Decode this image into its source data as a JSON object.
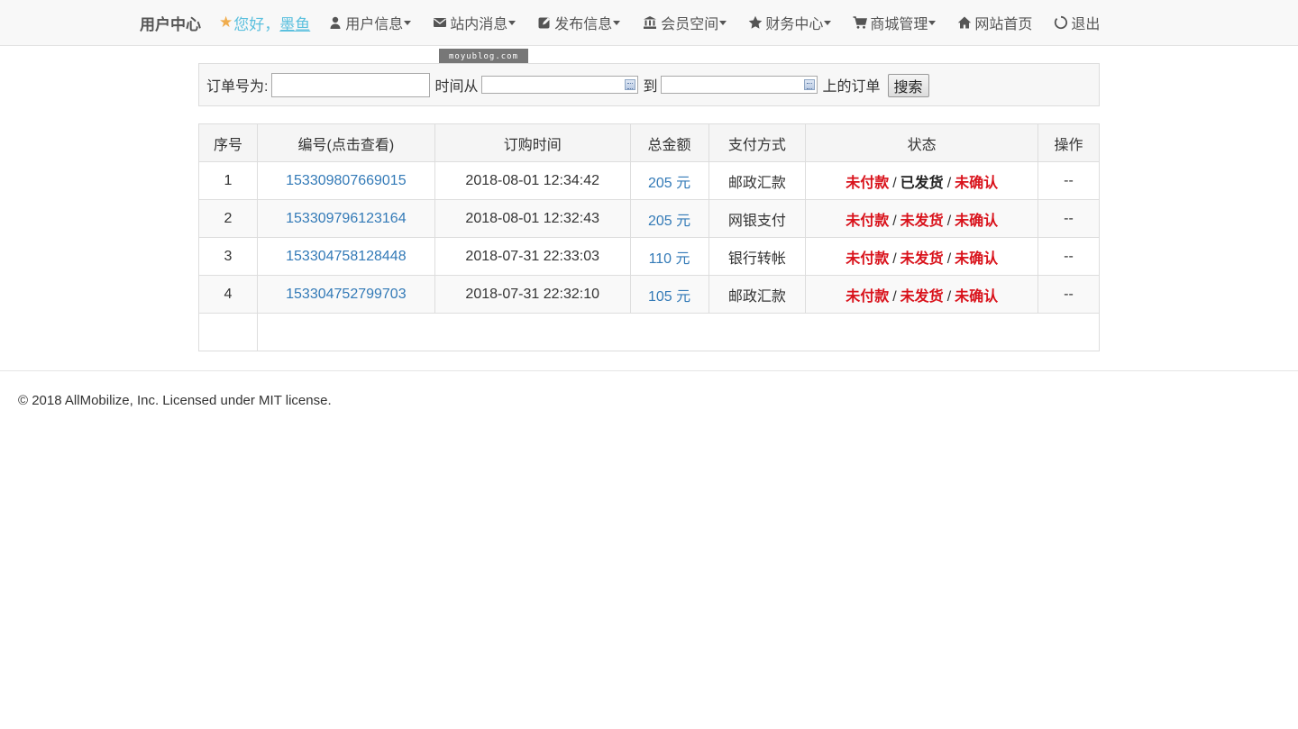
{
  "nav": {
    "brand": "用户中心",
    "greeting": "您好，",
    "username": "墨鱼",
    "items": [
      {
        "label": "用户信息",
        "icon": "user-icon",
        "dropdown": true
      },
      {
        "label": "站内消息",
        "icon": "envelope-icon",
        "dropdown": true
      },
      {
        "label": "发布信息",
        "icon": "edit-icon",
        "dropdown": true
      },
      {
        "label": "会员空间",
        "icon": "bank-icon",
        "dropdown": true
      },
      {
        "label": "财务中心",
        "icon": "star-icon",
        "dropdown": true
      },
      {
        "label": "商城管理",
        "icon": "cart-icon",
        "dropdown": true
      },
      {
        "label": "网站首页",
        "icon": "home-icon",
        "dropdown": false
      },
      {
        "label": "退出",
        "icon": "power-icon",
        "dropdown": false
      }
    ]
  },
  "watermark": "moyublog.com",
  "search": {
    "order_label": "订单号为:",
    "order_value": "",
    "from_label": "时间从",
    "date_from": "",
    "to_label": "到",
    "date_to": "",
    "suffix_label": "上的订单",
    "button_label": "搜索"
  },
  "table": {
    "headers": [
      "序号",
      "编号(点击查看)",
      "订购时间",
      "总金额",
      "支付方式",
      "状态",
      "操作"
    ],
    "rows": [
      {
        "index": "1",
        "order_no": "153309807669015",
        "time": "2018-08-01 12:34:42",
        "amount": "205 元",
        "payment": "邮政汇款",
        "pay_status": "未付款",
        "ship_status": "已发货",
        "confirm_status": "未确认",
        "action": "--"
      },
      {
        "index": "2",
        "order_no": "153309796123164",
        "time": "2018-08-01 12:32:43",
        "amount": "205 元",
        "payment": "网银支付",
        "pay_status": "未付款",
        "ship_status": "未发货",
        "confirm_status": "未确认",
        "action": "--"
      },
      {
        "index": "3",
        "order_no": "153304758128448",
        "time": "2018-07-31 22:33:03",
        "amount": "110 元",
        "payment": "银行转帐",
        "pay_status": "未付款",
        "ship_status": "未发货",
        "confirm_status": "未确认",
        "action": "--"
      },
      {
        "index": "4",
        "order_no": "153304752799703",
        "time": "2018-07-31 22:32:10",
        "amount": "105 元",
        "payment": "邮政汇款",
        "pay_status": "未付款",
        "ship_status": "未发货",
        "confirm_status": "未确认",
        "action": "--"
      }
    ],
    "status_separator": "/"
  },
  "footer": {
    "text": "© 2018 AllMobilize, Inc. Licensed under MIT license."
  },
  "colors": {
    "link": "#337ab7",
    "status_red": "#d9121b",
    "greeting": "#5bc0de",
    "star": "#f0ad4e"
  }
}
